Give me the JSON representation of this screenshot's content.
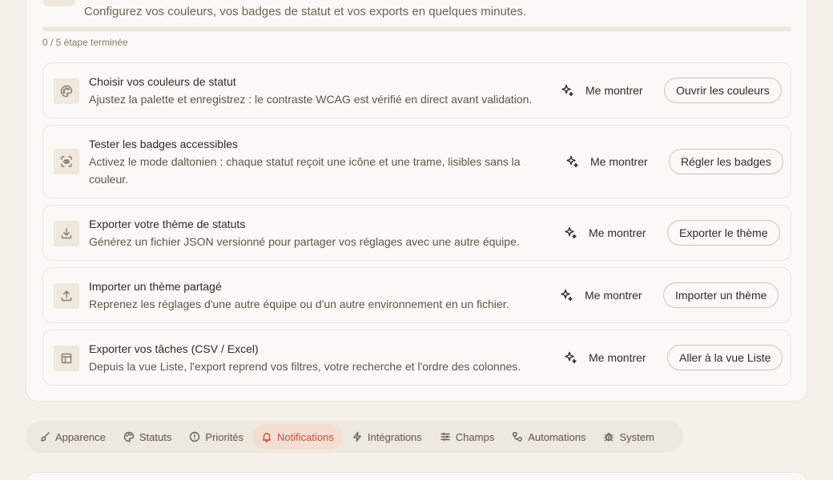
{
  "onboarding": {
    "subtitle": "Configurez vos couleurs, vos badges de statut et vos exports en quelques minutes.",
    "progress_text": "0 / 5 étape terminée",
    "progress_fraction": 0,
    "accent_color": "#c9603f",
    "show_me_label": "Me montrer",
    "steps": [
      {
        "icon": "palette-icon",
        "title": "Choisir vos couleurs de statut",
        "description": "Ajustez la palette et enregistrez : le contraste WCAG est vérifié en direct avant validation.",
        "action": "Ouvrir les couleurs"
      },
      {
        "icon": "eye-scan-icon",
        "title": "Tester les badges accessibles",
        "description": "Activez le mode daltonien : chaque statut reçoit une icône et une trame, lisibles sans la couleur.",
        "action": "Régler les badges"
      },
      {
        "icon": "download-icon",
        "title": "Exporter votre thème de statuts",
        "description": "Générez un fichier JSON versionné pour partager vos réglages avec une autre équipe.",
        "action": "Exporter le thème"
      },
      {
        "icon": "upload-icon",
        "title": "Importer un thème partagé",
        "description": "Reprenez les réglages d'une autre équipe ou d'un autre environnement en un fichier.",
        "action": "Importer un thème"
      },
      {
        "icon": "table-icon",
        "title": "Exporter vos tâches (CSV / Excel)",
        "description": "Depuis la vue Liste, l'export reprend vos filtres, votre recherche et l'ordre des colonnes.",
        "action": "Aller à la vue Liste"
      }
    ]
  },
  "tabs": [
    {
      "label": "Apparence",
      "icon": "brush-icon",
      "active": false
    },
    {
      "label": "Statuts",
      "icon": "palette-icon",
      "active": false
    },
    {
      "label": "Priorités",
      "icon": "alert-circle-icon",
      "active": false
    },
    {
      "label": "Notifications",
      "icon": "bell-icon",
      "active": true
    },
    {
      "label": "Intégrations",
      "icon": "zap-icon",
      "active": false
    },
    {
      "label": "Champs",
      "icon": "sliders-icon",
      "active": false
    },
    {
      "label": "Automations",
      "icon": "workflow-icon",
      "active": false
    },
    {
      "label": "System",
      "icon": "bug-icon",
      "active": false
    }
  ],
  "colors": {
    "background": "#f5f1ea",
    "card": "#fbf9f5",
    "active_tab_bg": "#f4ddd3",
    "active_tab_text": "#c0553a"
  }
}
